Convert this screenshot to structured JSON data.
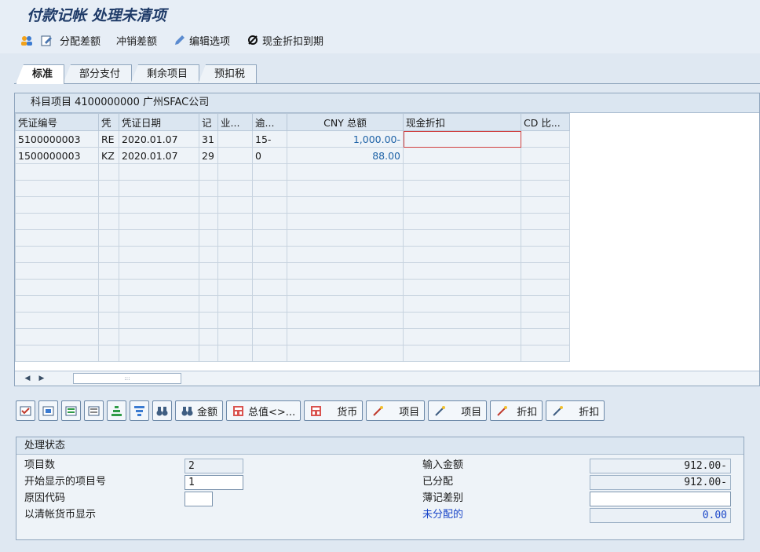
{
  "window": {
    "title": "付款记帐 处理未清项"
  },
  "toolbar": {
    "items": [
      "分配差额",
      "冲销差额",
      "编辑选项",
      "现金折扣到期"
    ]
  },
  "tabs": [
    "标准",
    "部分支付",
    "剩余项目",
    "预扣税"
  ],
  "table": {
    "title": "科目项目 4100000000 广州SFAC公司",
    "columns": [
      "凭证编号",
      "凭",
      "凭证日期",
      "记",
      "业...",
      "逾...",
      "CNY 总额",
      "现金折扣",
      "CD 比..."
    ],
    "rows": [
      [
        "5100000003",
        "RE",
        "2020.01.07",
        "31",
        "",
        "15-",
        "1,000.00-",
        "",
        ""
      ],
      [
        "1500000003",
        "KZ",
        "2020.01.07",
        "29",
        "",
        "0",
        "88.00",
        "",
        ""
      ]
    ],
    "scroll_thumb": ":::"
  },
  "buttons": {
    "amount": "金额",
    "total": "总值<>...",
    "currency": "货币",
    "item1": "项目",
    "item2": "项目",
    "discount1": "折扣",
    "discount2": "折扣"
  },
  "status": {
    "title": "处理状态",
    "item_count_label": "项目数",
    "item_count": "2",
    "start_item_label": "开始显示的项目号",
    "start_item": "1",
    "reason_label": "原因代码",
    "reason": "",
    "clearing_currency_label": "以清帐货币显示",
    "entered_amount_label": "输入金额",
    "entered_amount": "912.00-",
    "assigned_label": "已分配",
    "assigned": "912.00-",
    "posting_diff_label": "薄记差别",
    "posting_diff": "",
    "unassigned_label": "未分配的",
    "unassigned": "0.00"
  },
  "colors": {
    "accent": "#1f3b68",
    "highlight": "#fbe19f",
    "link": "#1a46c8"
  }
}
